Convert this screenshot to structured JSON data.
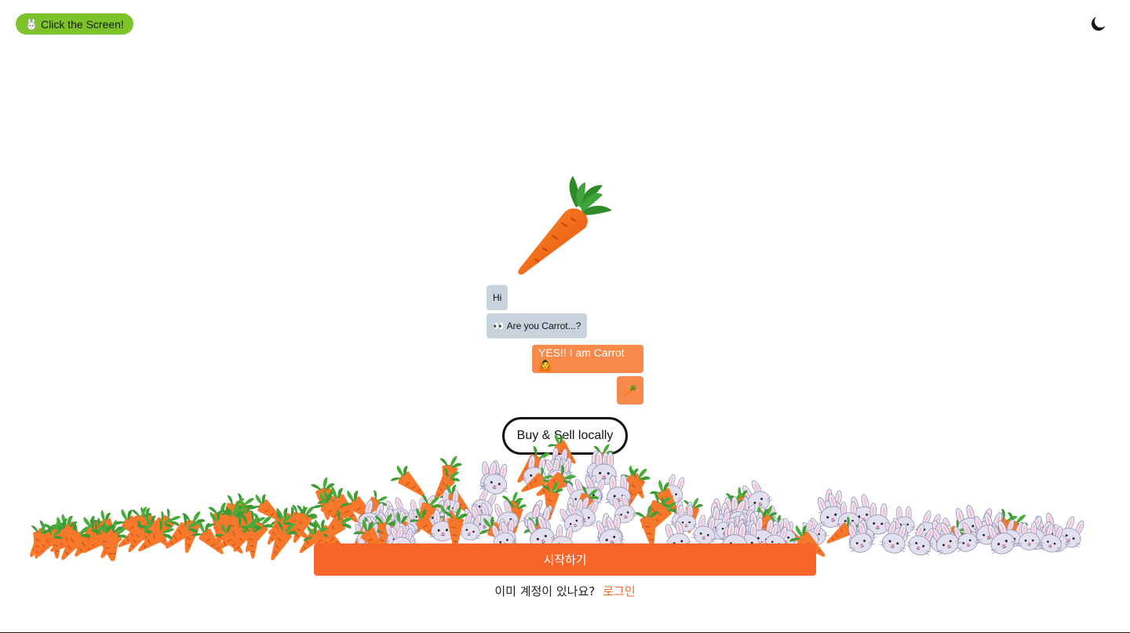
{
  "header": {
    "click_pill_label": "Click the Screen!",
    "click_pill_icon": "bunny-face-icon",
    "theme_toggle_icon": "moon-icon"
  },
  "hero": {
    "icon": "carrot-icon"
  },
  "chat": {
    "messages": [
      {
        "side": "left",
        "text": "Hi"
      },
      {
        "side": "left",
        "text": "👀 Are you Carrot...?"
      },
      {
        "side": "right",
        "text": "YES!! I am Carrot 🙆"
      },
      {
        "side": "right",
        "text": "🥕"
      }
    ]
  },
  "tagline": "Buy & Sell locally",
  "actions": {
    "start_label": "시작하기",
    "login_prompt": "이미 계정이 있나요?",
    "login_link": "로그인"
  },
  "colors": {
    "accent": "#f76628",
    "pill": "#7cc42a",
    "bubble_left": "#c9d3de",
    "bubble_right": "#f7894a"
  }
}
